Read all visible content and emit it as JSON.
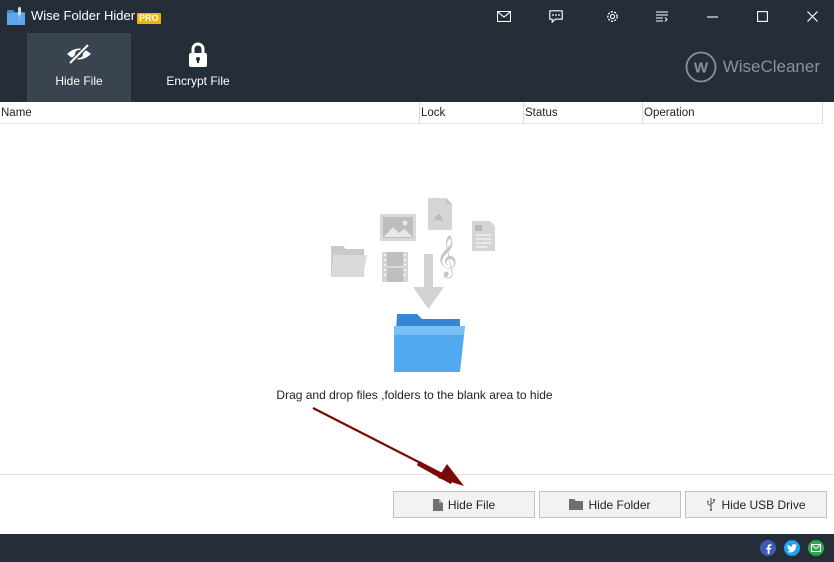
{
  "window": {
    "title": "Wise Folder Hider",
    "badge": "PRO"
  },
  "titlebar_buttons": [
    {
      "name": "mail-icon"
    },
    {
      "name": "feedback-icon"
    },
    {
      "name": "settings-icon"
    },
    {
      "name": "menu-icon"
    },
    {
      "name": "minimize-icon"
    },
    {
      "name": "maximize-icon"
    },
    {
      "name": "close-icon"
    }
  ],
  "toolbar": {
    "hide_file_label": "Hide File",
    "encrypt_file_label": "Encrypt File",
    "brand": "WiseCleaner",
    "brand_logo_letter": "W"
  },
  "table": {
    "columns": [
      "Name",
      "Lock",
      "Status",
      "Operation"
    ]
  },
  "content": {
    "drop_hint": "Drag and drop files ,folders to the blank area to hide"
  },
  "actions": {
    "hide_file": "Hide File",
    "hide_folder": "Hide Folder",
    "hide_usb": "Hide USB Drive"
  },
  "footer": {
    "social": [
      "facebook-icon",
      "twitter-icon",
      "email-icon"
    ]
  },
  "colors": {
    "chrome": "#252d38",
    "active_tab": "#3a4350",
    "pro_badge": "#f2b400",
    "arrow": "#7a0a0a",
    "facebook": "#3b5bb5",
    "twitter": "#1da1f2",
    "email": "#2eaa4a"
  }
}
